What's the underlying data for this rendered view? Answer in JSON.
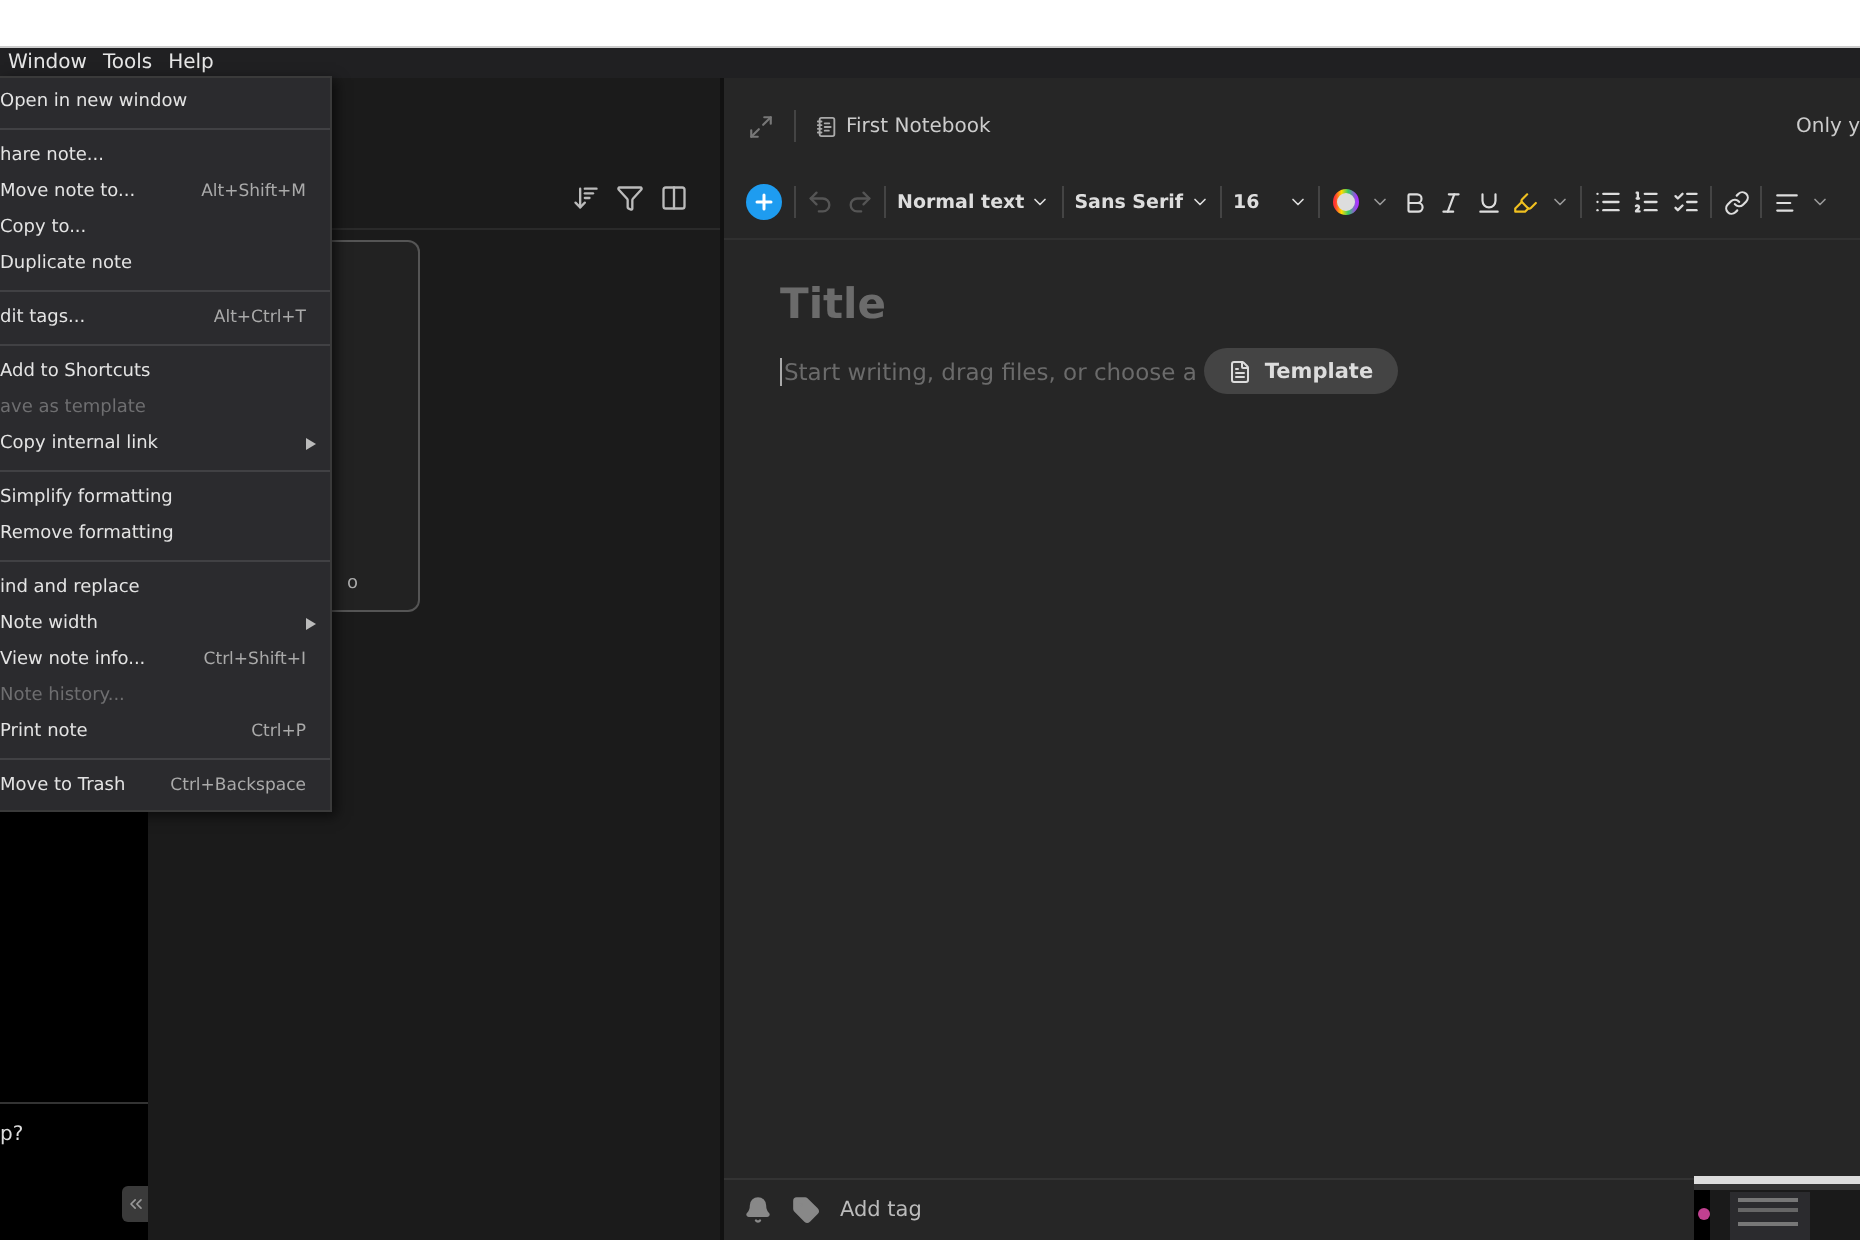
{
  "menu_bar": [
    {
      "label": "Window"
    },
    {
      "label": "Tools"
    },
    {
      "label": "Help"
    }
  ],
  "context_menu": {
    "groups": [
      [
        {
          "label": "Open in new window",
          "disabled": false
        }
      ],
      [
        {
          "label": "hare note...",
          "disabled": false
        },
        {
          "label": "Move note to...",
          "shortcut": "Alt+Shift+M",
          "disabled": false
        },
        {
          "label": "Copy to...",
          "disabled": false
        },
        {
          "label": "Duplicate note",
          "disabled": false
        }
      ],
      [
        {
          "label": "dit tags...",
          "shortcut": "Alt+Ctrl+T",
          "disabled": false
        }
      ],
      [
        {
          "label": "Add to Shortcuts",
          "disabled": false
        },
        {
          "label": "ave as template",
          "disabled": true
        },
        {
          "label": "Copy internal link",
          "submenu": true,
          "disabled": false
        }
      ],
      [
        {
          "label": "Simplify formatting",
          "disabled": false
        },
        {
          "label": "Remove formatting",
          "disabled": false
        }
      ],
      [
        {
          "label": "ind and replace",
          "disabled": false
        },
        {
          "label": "Note width",
          "submenu": true,
          "disabled": false
        },
        {
          "label": "View note info...",
          "shortcut": "Ctrl+Shift+I",
          "disabled": false
        },
        {
          "label": "Note history...",
          "disabled": true
        },
        {
          "label": "Print note",
          "shortcut": "Ctrl+P",
          "disabled": false
        }
      ],
      [
        {
          "label": "Move to Trash",
          "shortcut": "Ctrl+Backspace",
          "disabled": false
        }
      ]
    ]
  },
  "sidebar": {
    "bottom_text": "p?"
  },
  "note_list": {
    "card_text": "o"
  },
  "editor": {
    "notebook": "First Notebook",
    "share_text": "Only y",
    "toolbar": {
      "paragraph_style": "Normal text",
      "font": "Sans Serif",
      "font_size": "16"
    },
    "title_placeholder": "Title",
    "body_placeholder": "Start writing, drag files, or choose a",
    "template_button": "Template",
    "footer": {
      "add_tag": "Add tag"
    }
  }
}
